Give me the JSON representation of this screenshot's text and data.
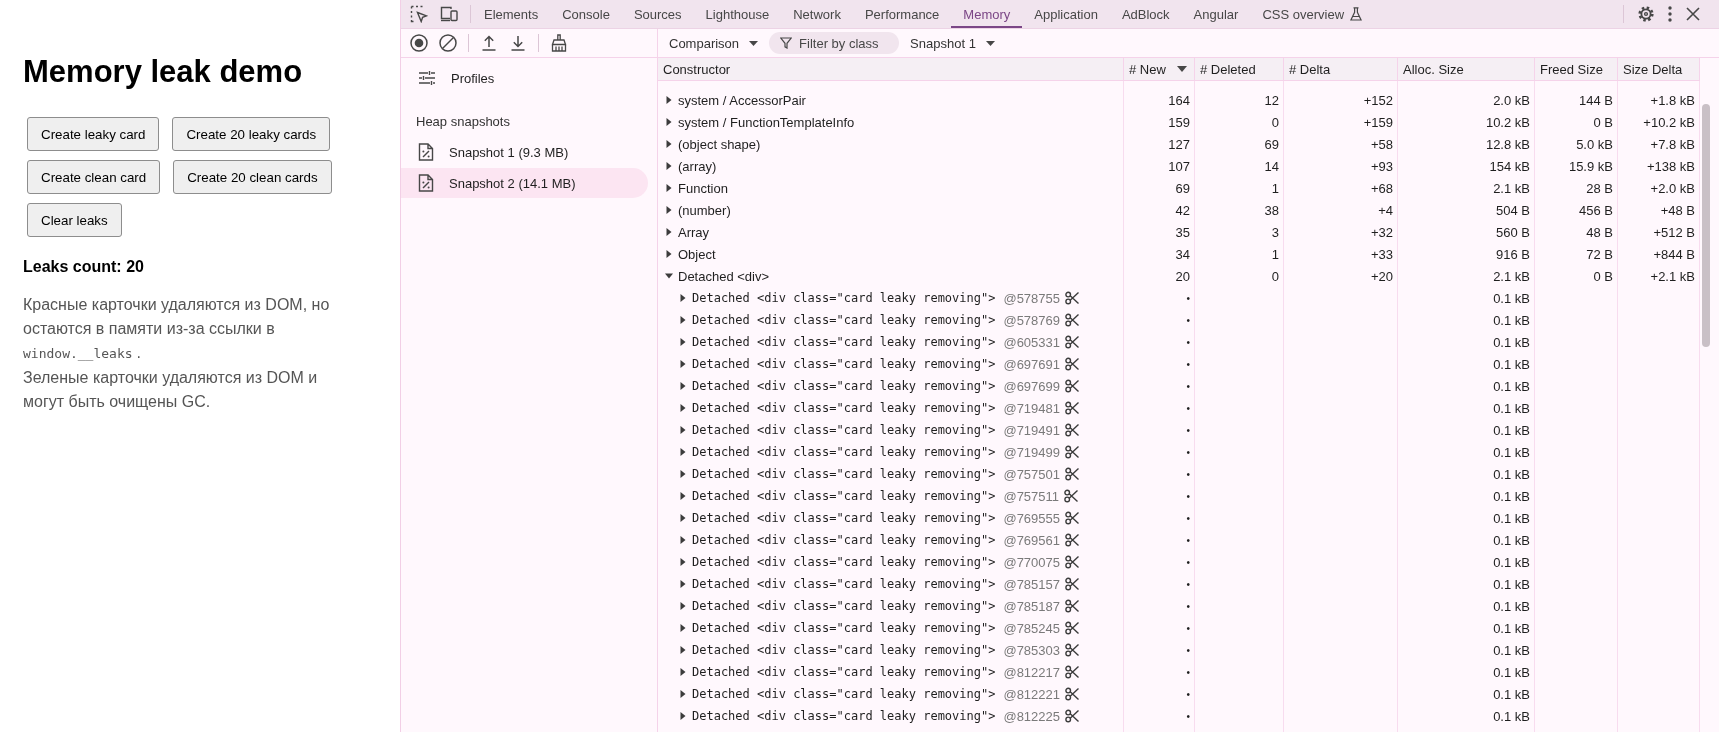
{
  "page": {
    "title": "Memory leak demo",
    "buttons": [
      "Create leaky card",
      "Create 20 leaky cards",
      "Create clean card",
      "Create 20 clean cards",
      "Clear leaks"
    ],
    "leaks_count": "Leaks count: 20",
    "notes": [
      {
        "text": "Красные карточки удаляются из DOM, но остаются в памяти из-за ссылки в",
        "code": "window.__leaks",
        "text_after": "."
      },
      {
        "text": "Зеленые карточки удаляются из DOM и могут быть очищены GC."
      }
    ]
  },
  "devtools": {
    "tabs": [
      {
        "label": "Elements",
        "selected": false,
        "experimental": false
      },
      {
        "label": "Console",
        "selected": false,
        "experimental": false
      },
      {
        "label": "Sources",
        "selected": false,
        "experimental": false
      },
      {
        "label": "Lighthouse",
        "selected": false,
        "experimental": false
      },
      {
        "label": "Network",
        "selected": false,
        "experimental": false
      },
      {
        "label": "Performance",
        "selected": false,
        "experimental": false
      },
      {
        "label": "Memory",
        "selected": true,
        "experimental": false
      },
      {
        "label": "Application",
        "selected": false,
        "experimental": false
      },
      {
        "label": "AdBlock",
        "selected": false,
        "experimental": false
      },
      {
        "label": "Angular",
        "selected": false,
        "experimental": false
      },
      {
        "label": "CSS overview",
        "selected": false,
        "experimental": true
      }
    ],
    "toolbar": {
      "view_mode": "Comparison",
      "filter": {
        "placeholder": "Filter by class"
      },
      "base_snapshot": "Snapshot 1"
    },
    "sidebar": {
      "profiles": "Profiles",
      "section_title": "Heap snapshots",
      "snapshots": [
        {
          "label": "Snapshot 1 (9.3 MB)",
          "selected": false
        },
        {
          "label": "Snapshot 2 (14.1 MB)",
          "selected": true
        }
      ]
    },
    "table": {
      "columns": [
        {
          "label": "Constructor",
          "sorted": false
        },
        {
          "label": "# New",
          "sorted": true
        },
        {
          "label": "# Deleted",
          "sorted": false
        },
        {
          "label": "# Delta",
          "sorted": false
        },
        {
          "label": "Alloc. Size",
          "sorted": false
        },
        {
          "label": "Freed Size",
          "sorted": false
        },
        {
          "label": "Size Delta",
          "sorted": false
        }
      ],
      "rows": [
        {
          "name": "system / AccessorPair",
          "expanded": false,
          "new": "164",
          "deleted": "12",
          "delta": "+152",
          "alloc_size": "2.0 kB",
          "freed_size": "144 B",
          "size_delta": "+1.8 kB"
        },
        {
          "name": "system / FunctionTemplateInfo",
          "expanded": false,
          "new": "159",
          "deleted": "0",
          "delta": "+159",
          "alloc_size": "10.2 kB",
          "freed_size": "0 B",
          "size_delta": "+10.2 kB"
        },
        {
          "name": "(object shape)",
          "expanded": false,
          "new": "127",
          "deleted": "69",
          "delta": "+58",
          "alloc_size": "12.8 kB",
          "freed_size": "5.0 kB",
          "size_delta": "+7.8 kB"
        },
        {
          "name": "(array)",
          "expanded": false,
          "new": "107",
          "deleted": "14",
          "delta": "+93",
          "alloc_size": "154 kB",
          "freed_size": "15.9 kB",
          "size_delta": "+138 kB"
        },
        {
          "name": "Function",
          "expanded": false,
          "new": "69",
          "deleted": "1",
          "delta": "+68",
          "alloc_size": "2.1 kB",
          "freed_size": "28 B",
          "size_delta": "+2.0 kB"
        },
        {
          "name": "(number)",
          "expanded": false,
          "new": "42",
          "deleted": "38",
          "delta": "+4",
          "alloc_size": "504 B",
          "freed_size": "456 B",
          "size_delta": "+48 B"
        },
        {
          "name": "Array",
          "expanded": false,
          "new": "35",
          "deleted": "3",
          "delta": "+32",
          "alloc_size": "560 B",
          "freed_size": "48 B",
          "size_delta": "+512 B"
        },
        {
          "name": "Object",
          "expanded": false,
          "new": "34",
          "deleted": "1",
          "delta": "+33",
          "alloc_size": "916 B",
          "freed_size": "72 B",
          "size_delta": "+844 B"
        },
        {
          "name": "Detached <div>",
          "expanded": true,
          "new": "20",
          "deleted": "0",
          "delta": "+20",
          "alloc_size": "2.1 kB",
          "freed_size": "0 B",
          "size_delta": "+2.1 kB",
          "children": [
            {
              "name": "Detached <div class=\"card leaky removing\">",
              "node_id": "@578755",
              "expanded": false,
              "new": "•",
              "alloc_size": "0.1 kB"
            },
            {
              "name": "Detached <div class=\"card leaky removing\">",
              "node_id": "@578769",
              "expanded": false,
              "new": "•",
              "alloc_size": "0.1 kB"
            },
            {
              "name": "Detached <div class=\"card leaky removing\">",
              "node_id": "@605331",
              "expanded": false,
              "new": "•",
              "alloc_size": "0.1 kB"
            },
            {
              "name": "Detached <div class=\"card leaky removing\">",
              "node_id": "@697691",
              "expanded": false,
              "new": "•",
              "alloc_size": "0.1 kB"
            },
            {
              "name": "Detached <div class=\"card leaky removing\">",
              "node_id": "@697699",
              "expanded": false,
              "new": "•",
              "alloc_size": "0.1 kB"
            },
            {
              "name": "Detached <div class=\"card leaky removing\">",
              "node_id": "@719481",
              "expanded": false,
              "new": "•",
              "alloc_size": "0.1 kB"
            },
            {
              "name": "Detached <div class=\"card leaky removing\">",
              "node_id": "@719491",
              "expanded": false,
              "new": "•",
              "alloc_size": "0.1 kB"
            },
            {
              "name": "Detached <div class=\"card leaky removing\">",
              "node_id": "@719499",
              "expanded": false,
              "new": "•",
              "alloc_size": "0.1 kB"
            },
            {
              "name": "Detached <div class=\"card leaky removing\">",
              "node_id": "@757501",
              "expanded": false,
              "new": "•",
              "alloc_size": "0.1 kB"
            },
            {
              "name": "Detached <div class=\"card leaky removing\">",
              "node_id": "@757511",
              "expanded": false,
              "new": "•",
              "alloc_size": "0.1 kB"
            },
            {
              "name": "Detached <div class=\"card leaky removing\">",
              "node_id": "@769555",
              "expanded": false,
              "new": "•",
              "alloc_size": "0.1 kB"
            },
            {
              "name": "Detached <div class=\"card leaky removing\">",
              "node_id": "@769561",
              "expanded": false,
              "new": "•",
              "alloc_size": "0.1 kB"
            },
            {
              "name": "Detached <div class=\"card leaky removing\">",
              "node_id": "@770075",
              "expanded": false,
              "new": "•",
              "alloc_size": "0.1 kB"
            },
            {
              "name": "Detached <div class=\"card leaky removing\">",
              "node_id": "@785157",
              "expanded": false,
              "new": "•",
              "alloc_size": "0.1 kB"
            },
            {
              "name": "Detached <div class=\"card leaky removing\">",
              "node_id": "@785187",
              "expanded": false,
              "new": "•",
              "alloc_size": "0.1 kB"
            },
            {
              "name": "Detached <div class=\"card leaky removing\">",
              "node_id": "@785245",
              "expanded": false,
              "new": "•",
              "alloc_size": "0.1 kB"
            },
            {
              "name": "Detached <div class=\"card leaky removing\">",
              "node_id": "@785303",
              "expanded": false,
              "new": "•",
              "alloc_size": "0.1 kB"
            },
            {
              "name": "Detached <div class=\"card leaky removing\">",
              "node_id": "@812217",
              "expanded": false,
              "new": "•",
              "alloc_size": "0.1 kB"
            },
            {
              "name": "Detached <div class=\"card leaky removing\">",
              "node_id": "@812221",
              "expanded": false,
              "new": "•",
              "alloc_size": "0.1 kB"
            },
            {
              "name": "Detached <div class=\"card leaky removing\">",
              "node_id": "@812225",
              "expanded": false,
              "new": "•",
              "alloc_size": "0.1 kB"
            }
          ]
        }
      ]
    }
  }
}
